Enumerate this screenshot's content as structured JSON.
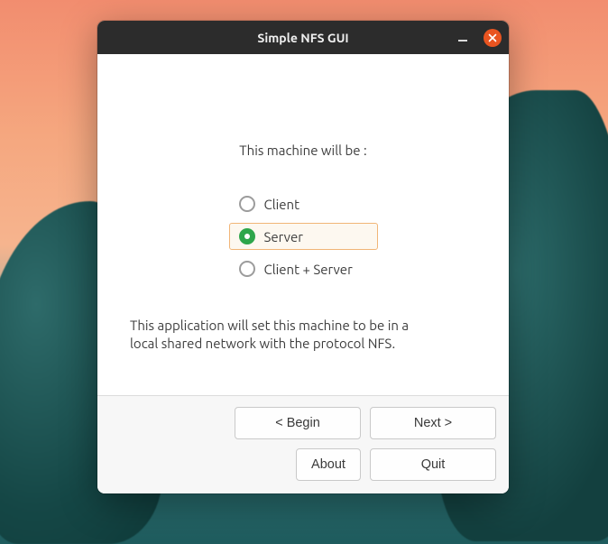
{
  "window": {
    "title": "Simple NFS GUI"
  },
  "content": {
    "prompt": "This machine will be :",
    "options": {
      "client": "Client",
      "server": "Server",
      "client_server": "Client + Server"
    },
    "selected": "server",
    "description": "This application will set this machine to be in a local shared network with the protocol NFS."
  },
  "buttons": {
    "begin": "< Begin",
    "next": "Next >",
    "about": "About",
    "quit": "Quit"
  },
  "colors": {
    "accent": "#2ea64b",
    "close": "#e95420",
    "focus_border": "#f1b577"
  }
}
